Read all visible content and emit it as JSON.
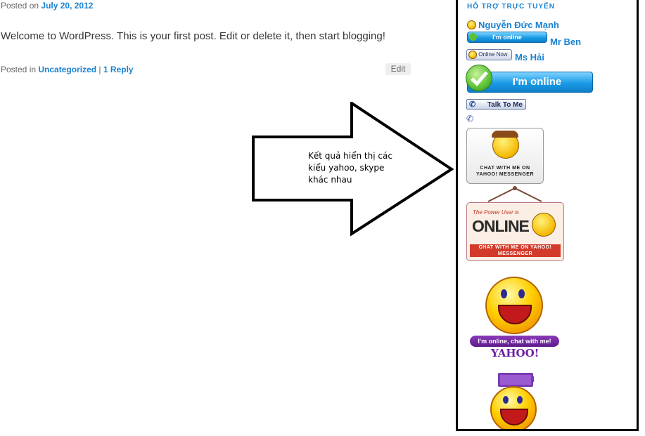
{
  "post": {
    "posted_on_prefix": "Posted on",
    "date": "July 20, 2012",
    "content": "Welcome to WordPress. This is your first post. Edit or delete it, then start blogging!",
    "posted_in_prefix": "Posted in",
    "category": "Uncategorized",
    "separator": "|",
    "reply": "1 Reply",
    "edit_label": "Edit"
  },
  "annotation": {
    "text": "Kết quả hiển thị các kiểu yahoo, skype khác nhau"
  },
  "sidebar": {
    "title": "HỖ TRỢ TRỰC TUYẾN",
    "contacts": [
      {
        "name": "Nguyễn Đức Mạnh",
        "badge": ""
      },
      {
        "name": "Mr Ben",
        "badge": "I'm online"
      },
      {
        "name": "Ms Hải",
        "badge": "Online Now"
      }
    ],
    "big_online_label": "I'm online",
    "talk_label": "Talk To Me",
    "card_text": "CHAT WITH ME ON YAHOO! MESSENGER",
    "sign_header": "The Power User is",
    "sign_online": "ONLINE",
    "sign_footer": "CHAT WITH ME ON YAHOO! MESSENGER",
    "pill_label": "I'm online, chat with me!",
    "yahoo_word": "YAHOO!"
  },
  "colors": {
    "link": "#1982d1",
    "sidebar_border": "#000000"
  }
}
